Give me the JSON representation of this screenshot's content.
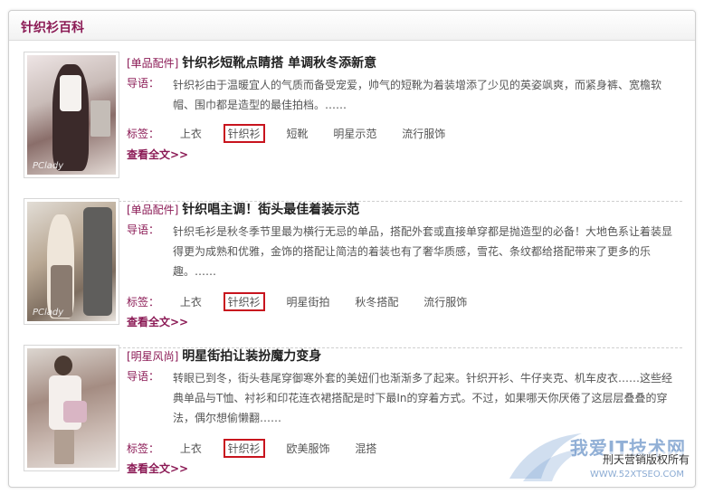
{
  "panel": {
    "title": "针织衫百科"
  },
  "common": {
    "intro_label": "导语：",
    "tags_label": "标签：",
    "more_label": "查看全文>>"
  },
  "articles": [
    {
      "category": "[单品配件]",
      "title": "针织衫短靴点睛搭 单调秋冬添新意",
      "intro": "针织衫由于温暖宜人的气质而备受宠爱，帅气的短靴为着装增添了少见的英姿飒爽，而紧身裤、宽檐软帽、围巾都是造型的最佳拍档。……",
      "tags": [
        "上衣",
        "针织衫",
        "短靴",
        "明星示范",
        "流行服饰"
      ],
      "highlight_tag": 1,
      "image_caption": "PClady"
    },
    {
      "category": "[单品配件]",
      "title": "针织唱主调！街头最佳着装示范",
      "intro": "针织毛衫是秋冬季节里最为横行无忌的单品，搭配外套或直接单穿都是抛造型的必备！大地色系让着装显得更为成熟和优雅，金饰的搭配让简洁的着装也有了奢华质感，雪花、条纹都给搭配带来了更多的乐趣。……",
      "tags": [
        "上衣",
        "针织衫",
        "明星街拍",
        "秋冬搭配",
        "流行服饰"
      ],
      "highlight_tag": 1,
      "image_caption": "PClady"
    },
    {
      "category": "[明星风尚]",
      "title": "明星街拍让装扮魔力变身",
      "intro": "转眼已到冬，街头巷尾穿御寒外套的美妞们也渐渐多了起来。针织开衫、牛仔夹克、机车皮衣……这些经典单品与T恤、衬衫和印花连衣裙搭配是时下最In的穿着方式。不过，如果哪天你厌倦了这层层叠叠的穿法，偶尔想偷懒翻……",
      "tags": [
        "上衣",
        "针织衫",
        "欧美服饰",
        "混搭"
      ],
      "highlight_tag": 1,
      "image_caption": ""
    }
  ],
  "watermark": {
    "brand": "我爱IT技术网",
    "domain": "WWW.52XTSEO.COM",
    "copyright": "刑天营销版权所有"
  },
  "colors": {
    "accent": "#8b1a55",
    "highlight_border": "#c8141e"
  }
}
